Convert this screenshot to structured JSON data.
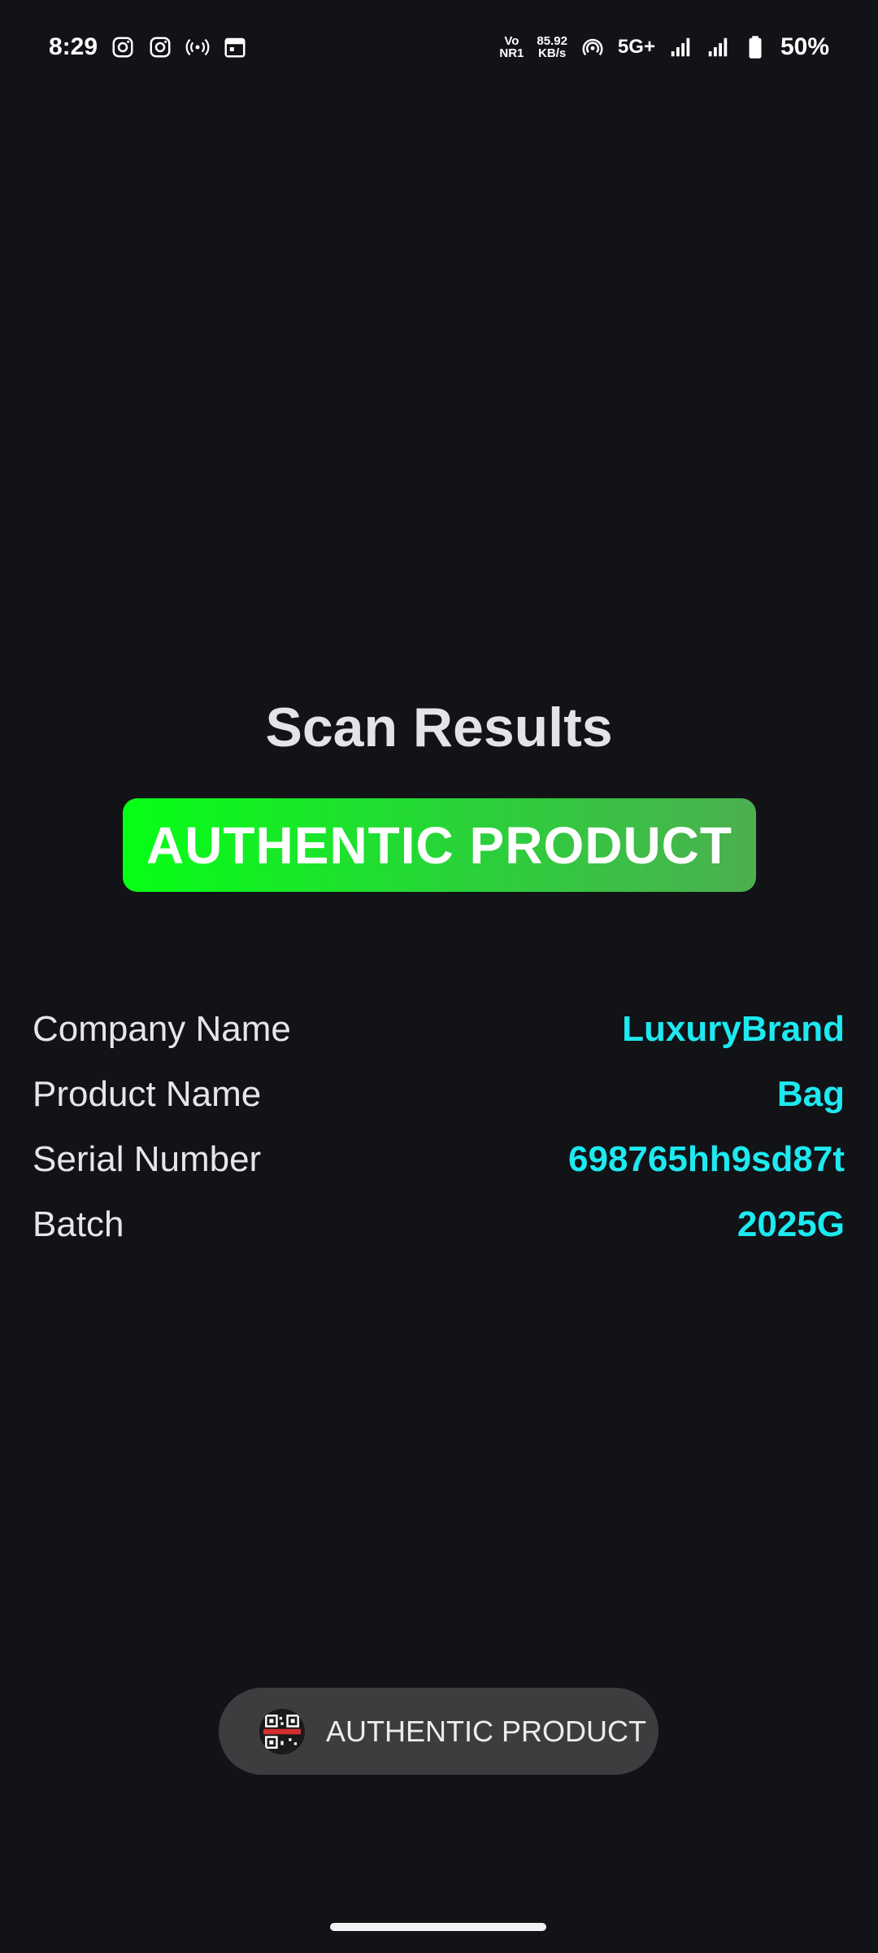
{
  "status_bar": {
    "time": "8:29",
    "network_top": "Vo",
    "network_bottom": "NR1",
    "speed_value": "85.92",
    "speed_unit": "KB/s",
    "network_type": "5G+",
    "battery": "50%"
  },
  "main": {
    "title": "Scan Results",
    "verdict": "AUTHENTIC PRODUCT",
    "details": [
      {
        "label": "Company Name",
        "value": "LuxuryBrand"
      },
      {
        "label": "Product Name",
        "value": "Bag"
      },
      {
        "label": "Serial Number",
        "value": "698765hh9sd87t"
      },
      {
        "label": "Batch",
        "value": "2025G"
      }
    ]
  },
  "toast": {
    "text": "AUTHENTIC PRODUCT",
    "icon": "app-logo-icon"
  },
  "colors": {
    "background": "#121317",
    "value_accent": "#1de9f0",
    "verdict_green": "#06ff16"
  }
}
